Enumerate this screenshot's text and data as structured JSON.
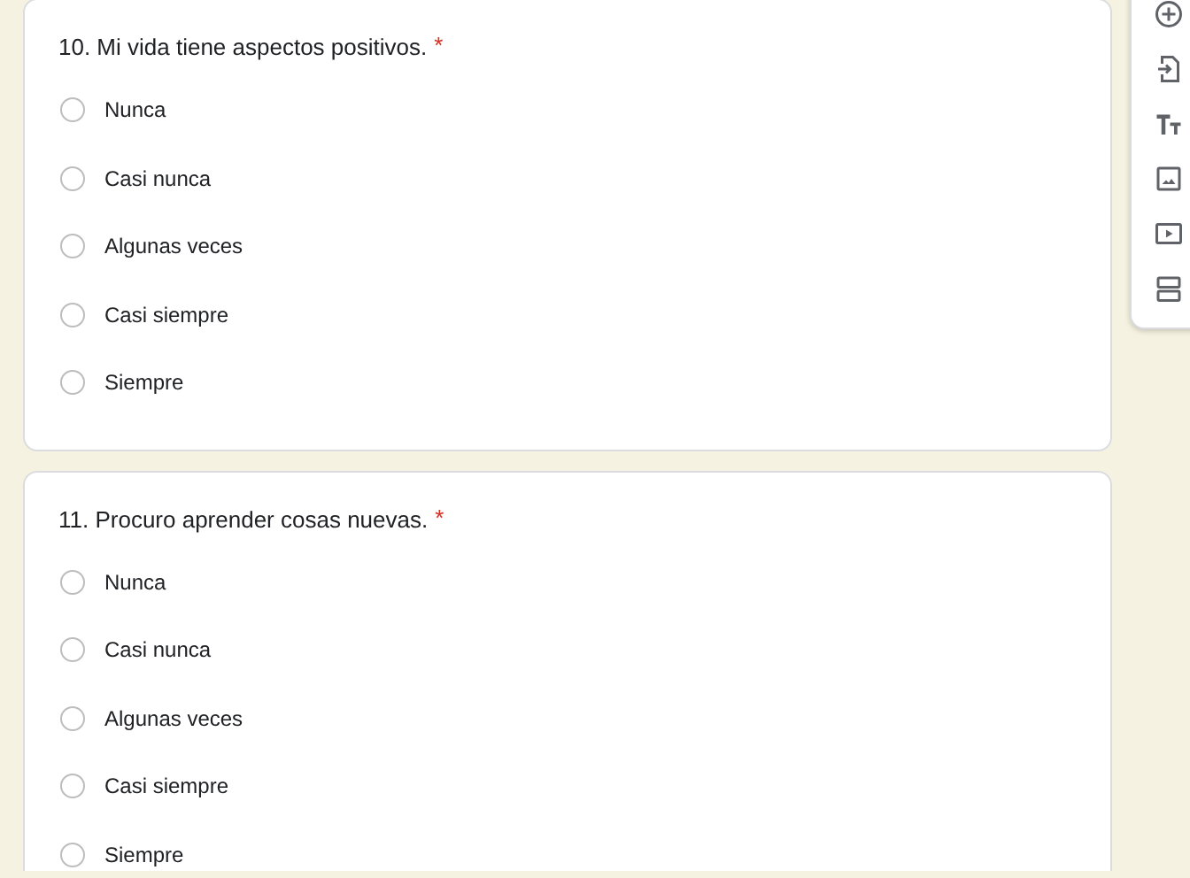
{
  "questions": [
    {
      "title": "10. Mi vida tiene aspectos positivos.",
      "required_mark": "*",
      "options": [
        {
          "label": "Nunca",
          "selected": false
        },
        {
          "label": "Casi nunca",
          "selected": false
        },
        {
          "label": "Algunas veces",
          "selected": false
        },
        {
          "label": "Casi siempre",
          "selected": false
        },
        {
          "label": "Siempre",
          "selected": false
        }
      ]
    },
    {
      "title": "11. Procuro aprender cosas nuevas.",
      "required_mark": "*",
      "options": [
        {
          "label": "Nunca",
          "selected": false
        },
        {
          "label": "Casi nunca",
          "selected": false
        },
        {
          "label": "Algunas veces",
          "selected": false
        },
        {
          "label": "Casi siempre",
          "selected": false
        },
        {
          "label": "Siempre",
          "selected": false
        }
      ]
    }
  ],
  "toolbar": [
    {
      "kind": "add"
    },
    {
      "kind": "import"
    },
    {
      "kind": "title"
    },
    {
      "kind": "image"
    },
    {
      "kind": "video"
    },
    {
      "kind": "section"
    }
  ]
}
